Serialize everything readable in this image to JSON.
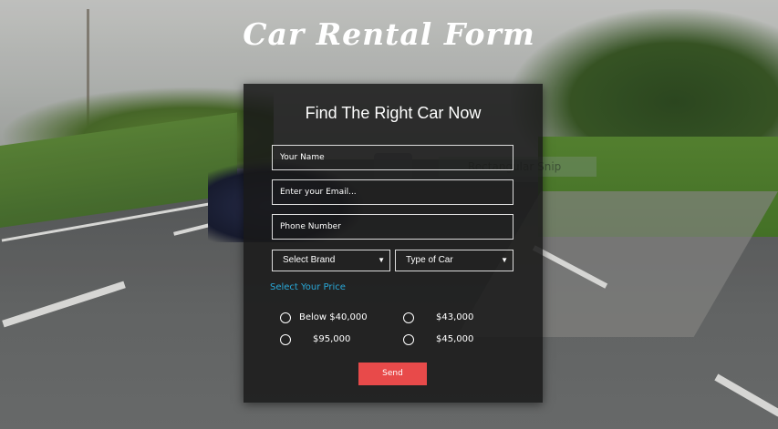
{
  "page": {
    "title": "Car Rental Form"
  },
  "background": {
    "ghost_snip_text": "Rectangular Snip"
  },
  "form": {
    "heading": "Find The Right Car Now",
    "fields": {
      "name_placeholder": "Your Name",
      "email_placeholder": "Enter your Email...",
      "phone_placeholder": "Phone Number"
    },
    "selects": {
      "brand": "Select Brand",
      "type": "Type of Car"
    },
    "price_label": "Select Your Price",
    "price_options": [
      {
        "label": "Below $40,000",
        "selected": false
      },
      {
        "label": "$43,000",
        "selected": false
      },
      {
        "label": "$95,000",
        "selected": false
      },
      {
        "label": "$45,000",
        "selected": false
      }
    ],
    "submit_label": "Send"
  },
  "colors": {
    "accent_blue": "#29a8d8",
    "button_red": "#e84a4a",
    "panel_bg": "#191919"
  }
}
